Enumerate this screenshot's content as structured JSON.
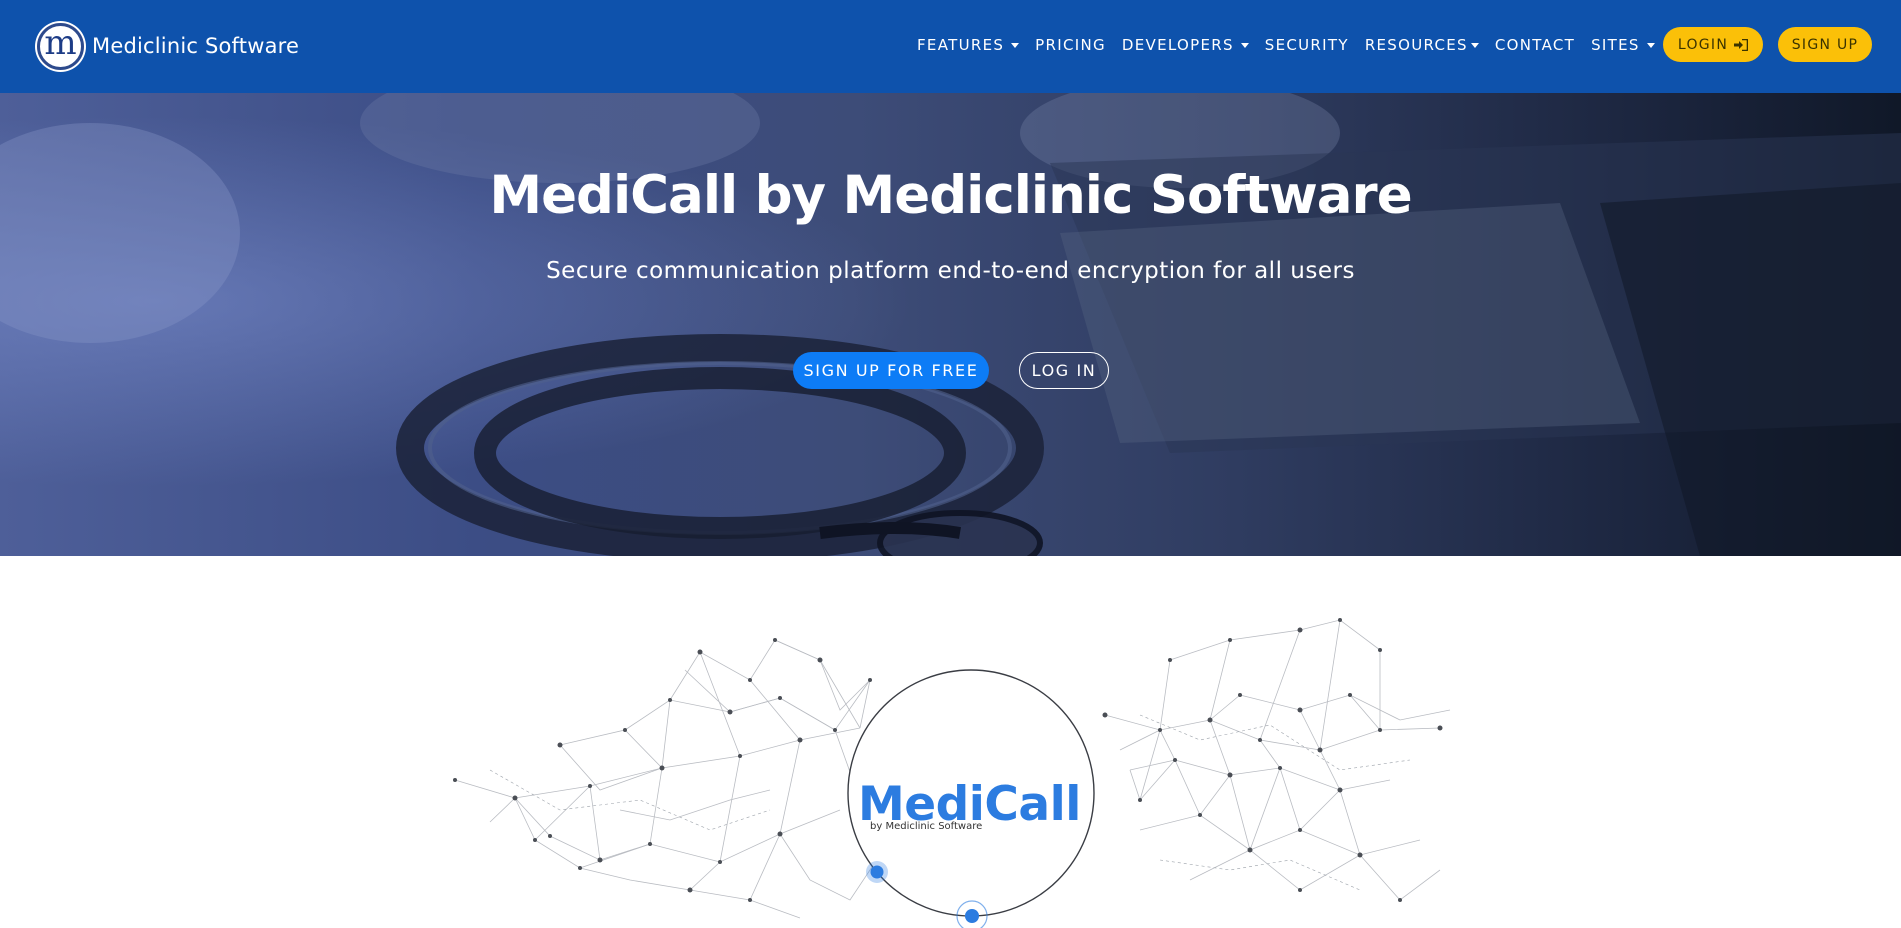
{
  "brand": {
    "logo_letter": "m",
    "name": "Mediclinic Software"
  },
  "nav": {
    "items": [
      {
        "label": "FEATURES",
        "has_dropdown": true
      },
      {
        "label": "PRICING",
        "has_dropdown": false
      },
      {
        "label": "DEVELOPERS",
        "has_dropdown": true
      },
      {
        "label": "SECURITY",
        "has_dropdown": false
      },
      {
        "label": "RESOURCES",
        "has_dropdown": true
      },
      {
        "label": "CONTACT",
        "has_dropdown": false
      },
      {
        "label": "SITES",
        "has_dropdown": true
      }
    ],
    "login_label": "LOGIN",
    "login_icon": "sign-in-icon",
    "signup_label": "SIGN UP"
  },
  "hero": {
    "title": "MediCall by Mediclinic Software",
    "subtitle": "Secure communication platform end-to-end encryption for all users",
    "signup_free_label": "SIGN UP FOR FREE",
    "login_label": "LOG IN"
  },
  "product_graphic": {
    "name": "MediCall",
    "byline": "by Mediclinic Software"
  },
  "colors": {
    "navbar": "#0e52ac",
    "accent_yellow": "#fbc008",
    "primary_blue": "#0d7cf6",
    "medicall_blue": "#2c7ce0"
  }
}
